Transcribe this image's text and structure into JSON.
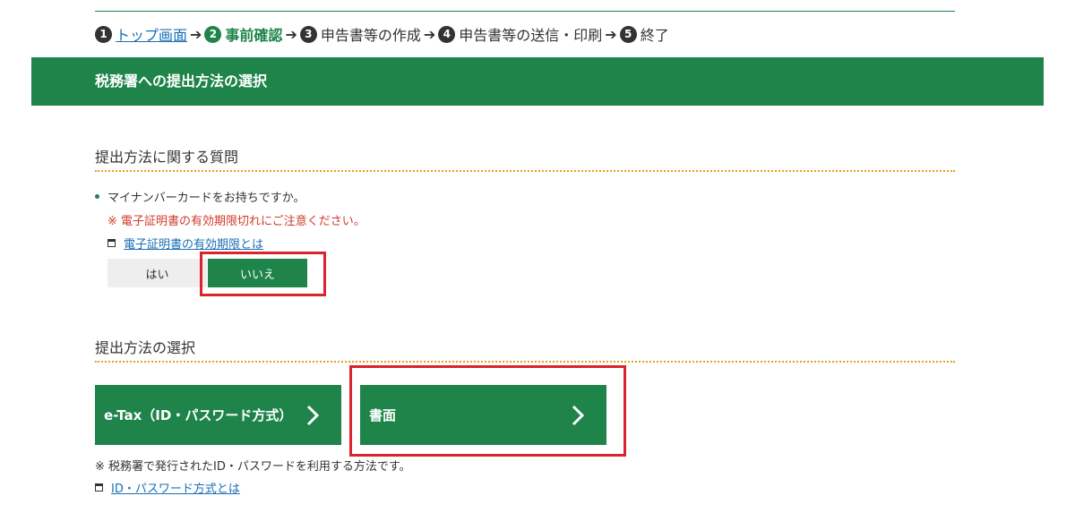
{
  "breadcrumb": {
    "steps": [
      {
        "num": "1",
        "label": "トップ画面",
        "state": "link"
      },
      {
        "num": "2",
        "label": "事前確認",
        "state": "current"
      },
      {
        "num": "3",
        "label": "申告書等の作成",
        "state": "normal"
      },
      {
        "num": "4",
        "label": "申告書等の送信・印刷",
        "state": "normal"
      },
      {
        "num": "5",
        "label": "終了",
        "state": "normal"
      }
    ],
    "arrow": "➔"
  },
  "banner": {
    "title": "税務署への提出方法の選択"
  },
  "question_section": {
    "heading": "提出方法に関する質問",
    "question": "マイナンバーカードをお持ちですか。",
    "warning": "※ 電子証明書の有効期限切れにご注意ください。",
    "link": "電子証明書の有効期限とは",
    "yes_label": "はい",
    "no_label": "いいえ",
    "selected": "いいえ"
  },
  "method_section": {
    "heading": "提出方法の選択",
    "etax_label": "e-Tax（ID・パスワード方式）",
    "paper_label": "書面",
    "note": "※ 税務署で発行されたID・パスワードを利用する方法です。",
    "link": "ID・パスワード方式とは"
  },
  "icons": {
    "chevron": "chevron-right-icon",
    "window": "new-window-icon"
  },
  "colors": {
    "primary_green": "#1e8449",
    "highlight_red": "#d9232d",
    "warning_red": "#d03b2b",
    "link_blue": "#1a6fb4",
    "dotted_orange": "#e3a21a"
  }
}
